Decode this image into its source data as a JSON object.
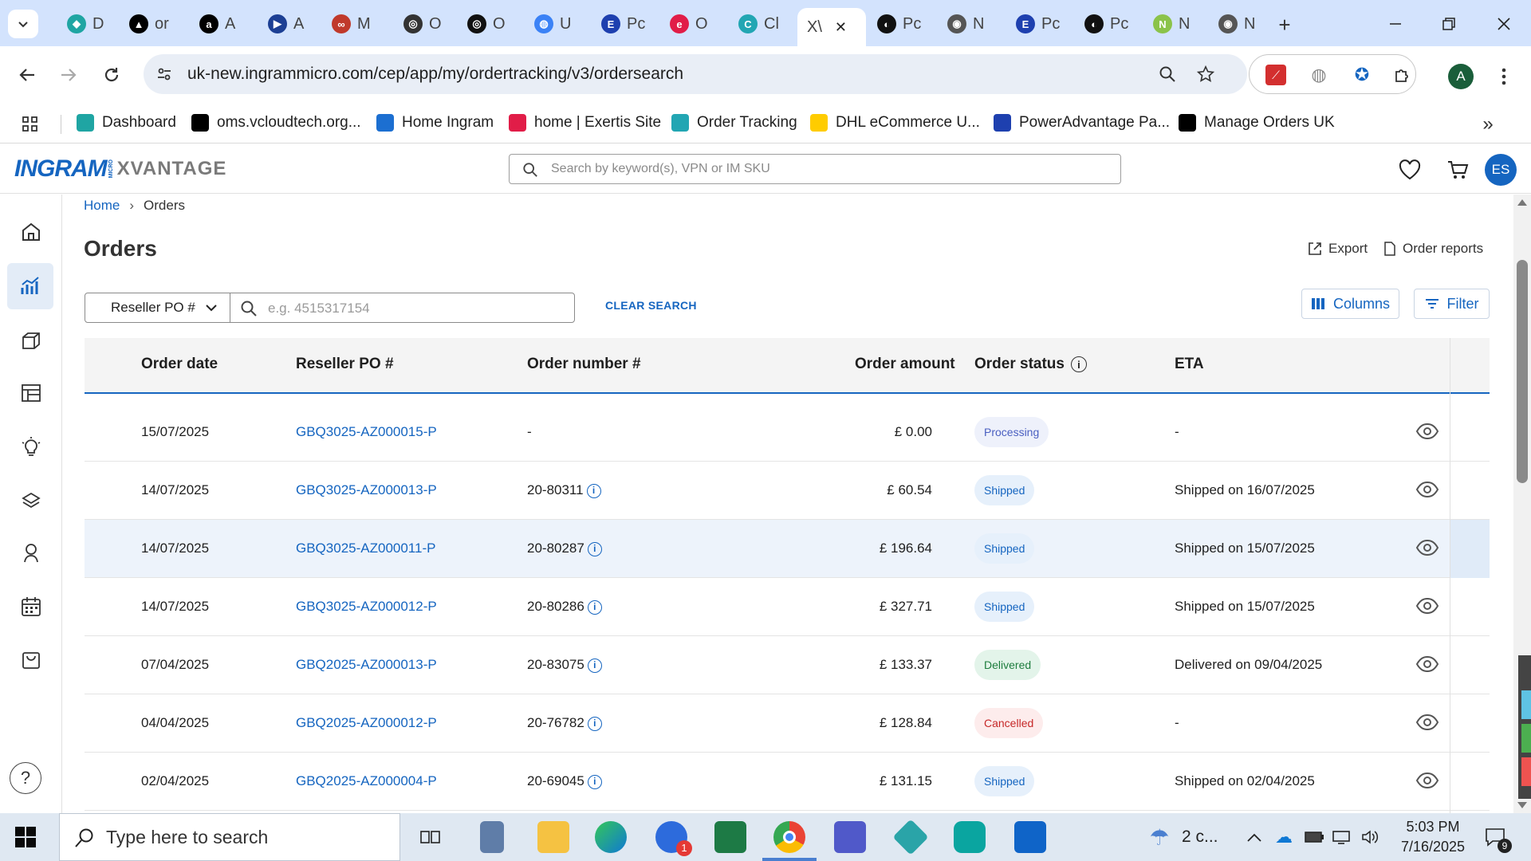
{
  "browser": {
    "tabs": [
      {
        "label": "D",
        "color": "#1fa5a3",
        "glyph": "◆"
      },
      {
        "label": "or",
        "color": "#000000",
        "glyph": "▲"
      },
      {
        "label": "A",
        "color": "#000000",
        "glyph": "a"
      },
      {
        "label": "A",
        "color": "#1c3f94",
        "glyph": "▶"
      },
      {
        "label": "M",
        "color": "#c0392b",
        "glyph": "∞"
      },
      {
        "label": "O",
        "color": "#333333",
        "glyph": "◎"
      },
      {
        "label": "O",
        "color": "#111111",
        "glyph": "◎"
      },
      {
        "label": "U",
        "color": "#3b82f6",
        "glyph": "◍"
      },
      {
        "label": "Pc",
        "color": "#1e40af",
        "glyph": "E"
      },
      {
        "label": "O",
        "color": "#e11d48",
        "glyph": "e"
      },
      {
        "label": "Cl",
        "color": "#22a6b3",
        "glyph": "C"
      },
      {
        "label": "X\\",
        "color": "#ffffff",
        "glyph": ""
      },
      {
        "label": "Pc",
        "color": "#111111",
        "glyph": "◐"
      },
      {
        "label": "N",
        "color": "#555555",
        "glyph": "◉"
      },
      {
        "label": "Pc",
        "color": "#1e40af",
        "glyph": "E"
      },
      {
        "label": "Pc",
        "color": "#111111",
        "glyph": "◐"
      },
      {
        "label": "N",
        "color": "#8bc34a",
        "glyph": "N"
      },
      {
        "label": "N",
        "color": "#555555",
        "glyph": "◉"
      }
    ],
    "url": "uk-new.ingrammicro.com/cep/app/my/ordertracking/v3/ordersearch",
    "profile_initial": "A",
    "bookmarks": [
      {
        "label": "Dashboard",
        "color": "#1fa5a3"
      },
      {
        "label": "oms.vcloudtech.org...",
        "color": "#000000"
      },
      {
        "label": "Home Ingram",
        "color": "#1c6fd1"
      },
      {
        "label": "home | Exertis Site",
        "color": "#e11d48"
      },
      {
        "label": "Order Tracking",
        "color": "#22a6b3"
      },
      {
        "label": "DHL eCommerce U...",
        "color": "#ffcc00"
      },
      {
        "label": "PowerAdvantage Pa...",
        "color": "#1e40af"
      },
      {
        "label": "Manage Orders UK",
        "color": "#000000"
      }
    ]
  },
  "site": {
    "logo_left": "INGRAM",
    "logo_micro": "MICRO",
    "logo_right": "XVANTAGE",
    "search_placeholder": "Search by keyword(s), VPN or IM SKU",
    "user_initials": "ES",
    "brand_color": "#1565c0"
  },
  "breadcrumb": {
    "home": "Home",
    "current": "Orders"
  },
  "page": {
    "title": "Orders",
    "export_label": "Export",
    "reports_label": "Order reports",
    "search_field_select": "Reseller PO #",
    "search_placeholder": "e.g. 4515317154",
    "clear_search": "CLEAR SEARCH",
    "columns_label": "Columns",
    "filter_label": "Filter"
  },
  "table": {
    "headers": {
      "order_date": "Order date",
      "reseller_po": "Reseller PO #",
      "order_number": "Order number #",
      "order_amount": "Order amount",
      "order_status": "Order status",
      "eta": "ETA"
    },
    "rows": [
      {
        "date": "15/07/2025",
        "po": "GBQ3025-AZ000015-P",
        "order": "-",
        "amount": "£ 0.00",
        "status": "Processing",
        "eta": "-"
      },
      {
        "date": "14/07/2025",
        "po": "GBQ3025-AZ000013-P",
        "order": "20-80311",
        "amount": "£ 60.54",
        "status": "Shipped",
        "eta": "Shipped on 16/07/2025"
      },
      {
        "date": "14/07/2025",
        "po": "GBQ3025-AZ000011-P",
        "order": "20-80287",
        "amount": "£ 196.64",
        "status": "Shipped",
        "eta": "Shipped on 15/07/2025"
      },
      {
        "date": "14/07/2025",
        "po": "GBQ3025-AZ000012-P",
        "order": "20-80286",
        "amount": "£ 327.71",
        "status": "Shipped",
        "eta": "Shipped on 15/07/2025"
      },
      {
        "date": "07/04/2025",
        "po": "GBQ2025-AZ000013-P",
        "order": "20-83075",
        "amount": "£ 133.37",
        "status": "Delivered",
        "eta": "Delivered on 09/04/2025"
      },
      {
        "date": "04/04/2025",
        "po": "GBQ2025-AZ000012-P",
        "order": "20-76782",
        "amount": "£ 128.84",
        "status": "Cancelled",
        "eta": "-"
      },
      {
        "date": "02/04/2025",
        "po": "GBQ2025-AZ000004-P",
        "order": "20-69045",
        "amount": "£ 131.15",
        "status": "Shipped",
        "eta": "Shipped on 02/04/2025"
      }
    ],
    "status_colors": {
      "Processing": {
        "bg": "#eef1fb",
        "fg": "#4a5fc1"
      },
      "Shipped": {
        "bg": "#e6f0fb",
        "fg": "#1565c0"
      },
      "Delivered": {
        "bg": "#e3f4ea",
        "fg": "#1e7d3e"
      },
      "Cancelled": {
        "bg": "#fdecec",
        "fg": "#c62828"
      }
    }
  },
  "taskbar": {
    "search_placeholder": "Type here to search",
    "weather": "2 c...",
    "time": "5:03 PM",
    "date": "7/16/2025",
    "notification_count": "9",
    "zoom_badge": "1"
  }
}
